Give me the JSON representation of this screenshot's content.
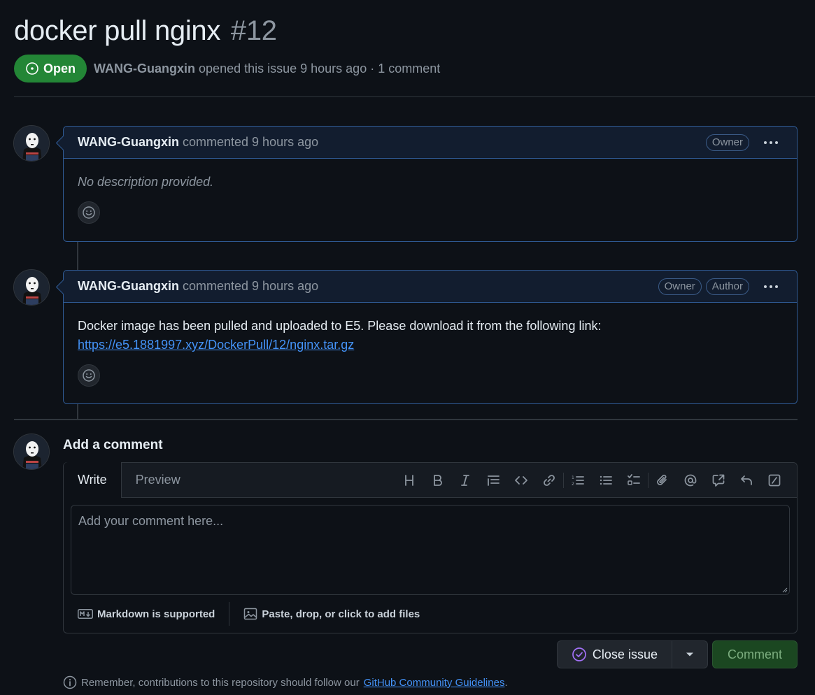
{
  "issue": {
    "title": "docker pull nginx",
    "number": "#12",
    "state": "Open",
    "author": "WANG-Guangxin",
    "meta_text": "opened this issue 9 hours ago · 1 comment"
  },
  "comments": [
    {
      "author": "WANG-Guangxin",
      "action": "commented 9 hours ago",
      "badges": [
        "Owner"
      ],
      "body_empty": "No description provided."
    },
    {
      "author": "WANG-Guangxin",
      "action": "commented 9 hours ago",
      "badges": [
        "Owner",
        "Author"
      ],
      "body_text": "Docker image has been pulled and uploaded to E5. Please download it from the following link:",
      "body_link": "https://e5.1881997.xyz/DockerPull/12/nginx.tar.gz"
    }
  ],
  "composer": {
    "title": "Add a comment",
    "tabs": [
      "Write",
      "Preview"
    ],
    "placeholder": "Add your comment here...",
    "markdown_note": "Markdown is supported",
    "files_note": "Paste, drop, or click to add files",
    "toolbar_icons": [
      "heading-icon",
      "bold-icon",
      "italic-icon",
      "quote-icon",
      "code-icon",
      "link-icon",
      "ordered-list-icon",
      "unordered-list-icon",
      "task-list-icon",
      "attach-icon",
      "mention-icon",
      "reference-icon",
      "reply-icon",
      "slash-command-icon"
    ]
  },
  "actions": {
    "close_issue": "Close issue",
    "comment": "Comment"
  },
  "footer": {
    "text": "Remember, contributions to this repository should follow our",
    "link": "GitHub Community Guidelines",
    "period": "."
  },
  "colors": {
    "background": "#0d1117",
    "open_green": "#238636",
    "accent_blue": "#2f5a94",
    "link": "#4493f8"
  }
}
